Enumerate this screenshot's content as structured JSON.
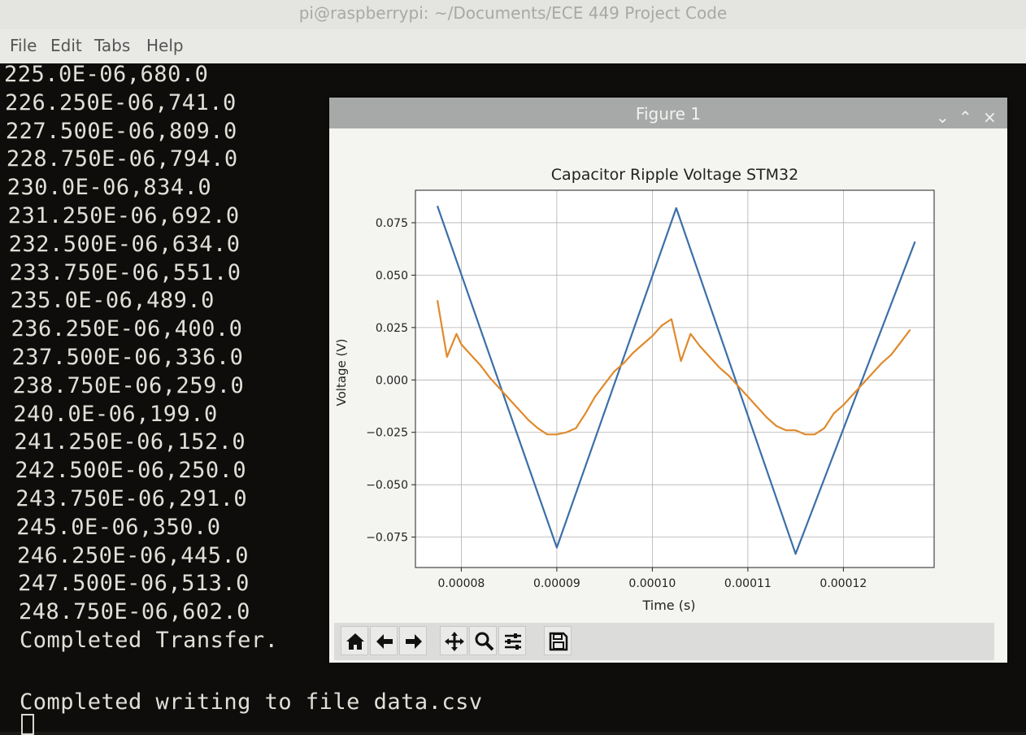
{
  "window": {
    "title": "pi@raspberrypi: ~/Documents/ECE 449 Project Code"
  },
  "menu": {
    "items": [
      "File",
      "Edit",
      "Tabs",
      "Help"
    ]
  },
  "terminal": {
    "lines": [
      "225.0E-06,680.0",
      "226.250E-06,741.0",
      "227.500E-06,809.0",
      "228.750E-06,794.0",
      "230.0E-06,834.0",
      "231.250E-06,692.0",
      "232.500E-06,634.0",
      "233.750E-06,551.0",
      "235.0E-06,489.0",
      "236.250E-06,400.0",
      "237.500E-06,336.0",
      "238.750E-06,259.0",
      "240.0E-06,199.0",
      "241.250E-06,152.0",
      "242.500E-06,250.0",
      "243.750E-06,291.0",
      "245.0E-06,350.0",
      "246.250E-06,445.0",
      "247.500E-06,513.0",
      "248.750E-06,602.0",
      "Completed Transfer."
    ],
    "status": "Completed writing to file data.csv"
  },
  "figure": {
    "window_title": "Figure 1",
    "controls": {
      "minimize": "⌄",
      "maximize": "⌃",
      "close": "×"
    },
    "toolbar_icons": [
      "home-icon",
      "back-icon",
      "forward-icon",
      "pan-icon",
      "zoom-icon",
      "configure-icon",
      "save-icon"
    ]
  },
  "chart_data": {
    "type": "line",
    "title": "Capacitor Ripple Voltage STM32",
    "xlabel": "Time (s)",
    "ylabel": "Voltage (V)",
    "xlim": [
      7.52e-05,
      0.0001295
    ],
    "ylim": [
      -0.0895,
      0.0905
    ],
    "grid": true,
    "xticks": [
      8e-05,
      9e-05,
      0.0001,
      0.00011,
      0.00012
    ],
    "xtick_labels": [
      "0.00008",
      "0.00009",
      "0.00010",
      "0.00011",
      "0.00012"
    ],
    "yticks": [
      0.075,
      0.05,
      0.025,
      0.0,
      -0.025,
      -0.05,
      -0.075
    ],
    "ytick_labels": [
      "0.075",
      "0.050",
      "0.025",
      "0.000",
      "−0.025",
      "−0.050",
      "−0.075"
    ],
    "colors": {
      "series1": "#3b6fa8",
      "series2": "#e08a2c"
    },
    "series": [
      {
        "x": [
          7.75e-05,
          9e-05,
          0.0001025,
          0.000115,
          0.0001275
        ],
        "y": [
          0.083,
          -0.08,
          0.082,
          -0.083,
          0.066
        ]
      },
      {
        "x": [
          7.75e-05,
          7.85e-05,
          7.95e-05,
          8e-05,
          8.1e-05,
          8.2e-05,
          8.3e-05,
          8.4e-05,
          8.5e-05,
          8.6e-05,
          8.7e-05,
          8.8e-05,
          8.9e-05,
          9e-05,
          9.1e-05,
          9.2e-05,
          9.3e-05,
          9.4e-05,
          9.5e-05,
          9.6e-05,
          9.7e-05,
          9.8e-05,
          9.9e-05,
          0.0001,
          0.000101,
          0.000102,
          0.000103,
          0.000104,
          0.000105,
          0.000106,
          0.000107,
          0.000108,
          0.000109,
          0.00011,
          0.000111,
          0.000112,
          0.000113,
          0.000114,
          0.000115,
          0.000116,
          0.000117,
          0.000118,
          0.000119,
          0.00012,
          0.000121,
          0.000122,
          0.000123,
          0.000124,
          0.000125,
          0.000126,
          0.000127
        ],
        "y": [
          0.038,
          0.011,
          0.022,
          0.017,
          0.012,
          0.007,
          0.001,
          -0.004,
          -0.009,
          -0.014,
          -0.019,
          -0.023,
          -0.026,
          -0.026,
          -0.025,
          -0.023,
          -0.016,
          -0.008,
          -0.002,
          0.004,
          0.008,
          0.013,
          0.017,
          0.021,
          0.026,
          0.029,
          0.009,
          0.022,
          0.016,
          0.011,
          0.006,
          0.002,
          -0.003,
          -0.008,
          -0.013,
          -0.018,
          -0.022,
          -0.024,
          -0.024,
          -0.026,
          -0.026,
          -0.023,
          -0.016,
          -0.012,
          -0.007,
          -0.002,
          0.003,
          0.008,
          0.012,
          0.018,
          0.024
        ]
      }
    ]
  }
}
